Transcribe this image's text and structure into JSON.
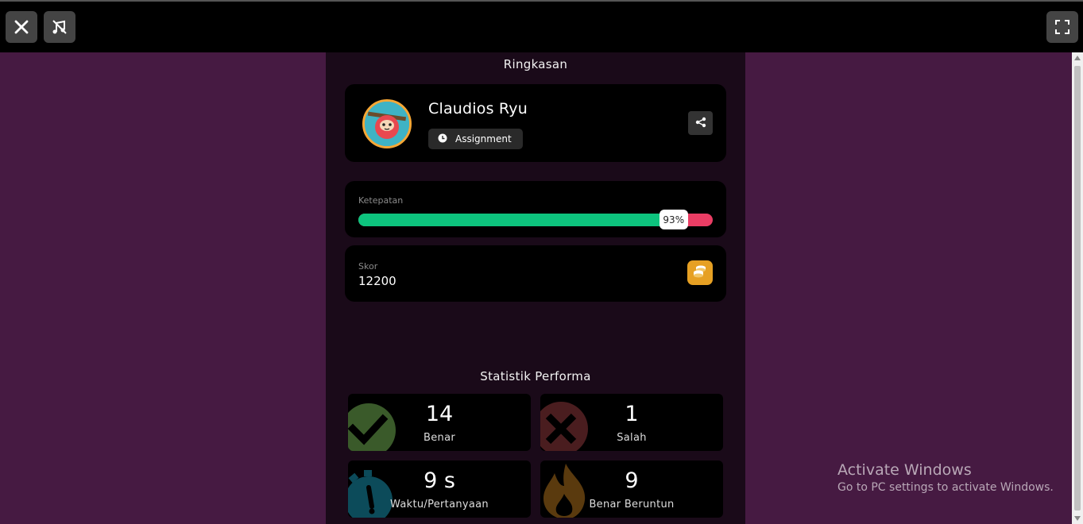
{
  "toolbar": {
    "close_icon": "close-icon",
    "music_off_icon": "music-off-icon",
    "fullscreen_icon": "fullscreen-icon"
  },
  "summary": {
    "title": "Ringkasan",
    "player": {
      "name": "Claudios Ryu",
      "mode": "Assignment",
      "mode_icon": "clock-icon",
      "share_icon": "share-icon"
    },
    "accuracy": {
      "label": "Ketepatan",
      "percent_text": "93%",
      "fraction": 0.93,
      "correct_color": "#0dc47e",
      "incorrect_color": "#ea3d64"
    },
    "score": {
      "label": "Skor",
      "value": "12200",
      "icon": "coins-icon"
    }
  },
  "performance": {
    "title": "Statistik Performa",
    "stats": [
      {
        "value": "14",
        "label": "Benar",
        "icon": "check-icon"
      },
      {
        "value": "1",
        "label": "Salah",
        "icon": "cross-icon"
      },
      {
        "value": "9 s",
        "label": "Waktu/Pertanyaan",
        "icon": "stopwatch-icon"
      },
      {
        "value": "9",
        "label": "Benar Beruntun",
        "icon": "flame-icon"
      }
    ]
  },
  "watermark": {
    "line1": "Activate Windows",
    "line2": "Go to PC settings to activate Windows."
  },
  "colors": {
    "page_bg": "#461a42",
    "panel_bg": "#1a0a19",
    "card_bg": "#000000",
    "coin_accent": "#e6a023"
  }
}
